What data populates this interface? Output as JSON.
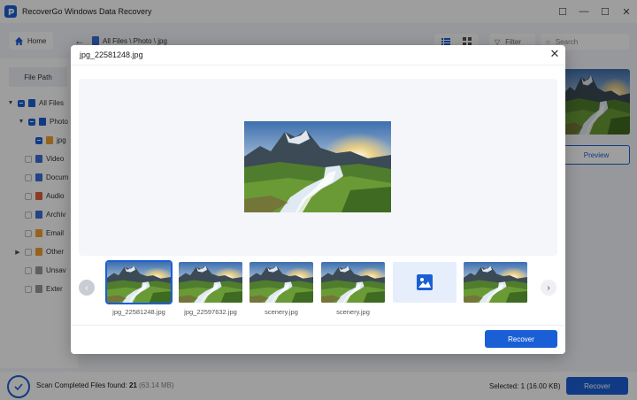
{
  "app": {
    "title": "RecoverGo Windows Data Recovery",
    "window_controls": [
      "☐",
      "—",
      "☐",
      "✕"
    ]
  },
  "toolbar": {
    "home_label": "Home",
    "breadcrumb": "All Files \\ Photo \\ jpg",
    "filter_label": "Filter",
    "search_placeholder": "Search"
  },
  "sidebar": {
    "tab_label": "File Path",
    "items": [
      {
        "label": "All Files",
        "color": "#1a5fd6"
      },
      {
        "label": "Photo",
        "color": "#1a5fd6"
      },
      {
        "label": "jpg",
        "color": "#f0a030"
      },
      {
        "label": "Video",
        "color": "#3b6fd8"
      },
      {
        "label": "Docum",
        "color": "#3b6fd8"
      },
      {
        "label": "Audio",
        "color": "#e0603a"
      },
      {
        "label": "Archiv",
        "color": "#3b6fd8"
      },
      {
        "label": "Email",
        "color": "#f0a030"
      },
      {
        "label": "Other",
        "color": "#f0a030"
      },
      {
        "label": "Unsav",
        "color": "#999999"
      },
      {
        "label": "Exter",
        "color": "#999999"
      }
    ]
  },
  "right_pane": {
    "preview_label": "Preview"
  },
  "status": {
    "scan_prefix": "Scan Completed Files found: ",
    "files_found": "21",
    "total_size": "(63.14 MB)",
    "selected": "Selected:  1 (16.00 KB)",
    "recover_label": "Recover"
  },
  "modal": {
    "title": "jpg_22581248.jpg",
    "recover_label": "Recover",
    "thumbnails": [
      {
        "label": "jpg_22581248.jpg",
        "active": true,
        "placeholder": false
      },
      {
        "label": "jpg_22597632.jpg",
        "active": false,
        "placeholder": false
      },
      {
        "label": "scenery.jpg",
        "active": false,
        "placeholder": false
      },
      {
        "label": "scenery.jpg",
        "active": false,
        "placeholder": false
      },
      {
        "label": "",
        "active": false,
        "placeholder": true
      },
      {
        "label": "",
        "active": false,
        "placeholder": false
      }
    ]
  },
  "colors": {
    "accent": "#1a5fd6"
  }
}
